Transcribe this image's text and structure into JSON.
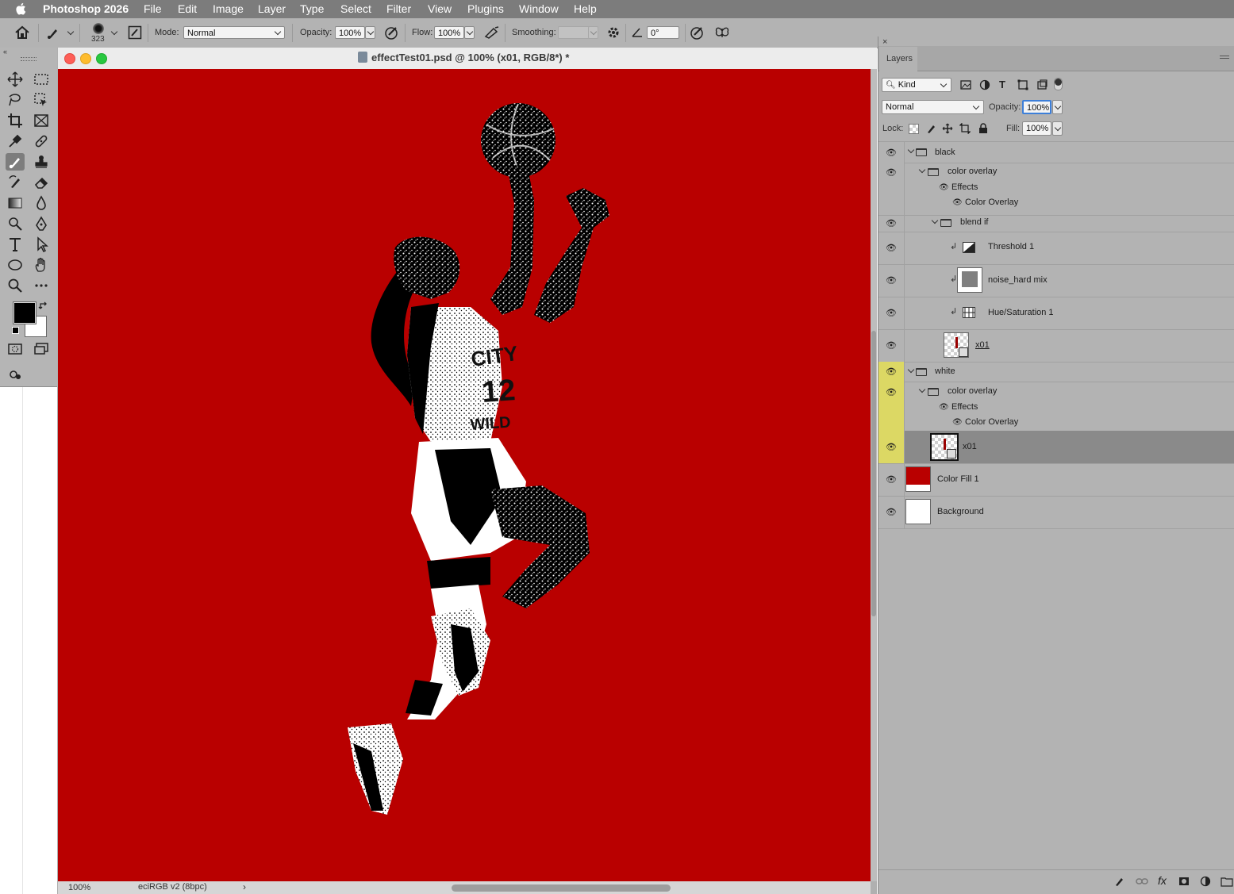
{
  "menubar": {
    "app_name": "Photoshop 2026",
    "items": [
      "File",
      "Edit",
      "Image",
      "Layer",
      "Type",
      "Select",
      "Filter",
      "View",
      "Plugins",
      "Window",
      "Help"
    ]
  },
  "options": {
    "brush_size": "323",
    "mode_label": "Mode:",
    "mode_value": "Normal",
    "opacity_label": "Opacity:",
    "opacity_value": "100%",
    "flow_label": "Flow:",
    "flow_value": "100%",
    "smoothing_label": "Smoothing:",
    "smoothing_value": "",
    "angle_value": "0°"
  },
  "document": {
    "title": "effectTest01.psd @ 100% (x01, RGB/8*) *",
    "zoom": "100%",
    "color_profile": "eciRGB v2 (8bpc)",
    "canvas_color": "#b90000"
  },
  "layers_panel": {
    "tab": "Layers",
    "filter_kind": "Kind",
    "blend_mode": "Normal",
    "opacity_label": "Opacity:",
    "opacity_value": "100%",
    "lock_label": "Lock:",
    "fill_label": "Fill:",
    "fill_value": "100%",
    "layers": [
      {
        "name": "black",
        "kind": "group"
      },
      {
        "name": "color overlay",
        "kind": "group"
      },
      {
        "name": "Effects",
        "kind": "effects"
      },
      {
        "name": "Color Overlay",
        "kind": "effect"
      },
      {
        "name": "blend if",
        "kind": "group"
      },
      {
        "name": "Threshold 1",
        "kind": "adjustment"
      },
      {
        "name": "noise_hard mix",
        "kind": "pixel"
      },
      {
        "name": "Hue/Saturation 1",
        "kind": "adjustment"
      },
      {
        "name": "x01",
        "kind": "smart-object"
      },
      {
        "name": "white",
        "kind": "group"
      },
      {
        "name": "color overlay",
        "kind": "group"
      },
      {
        "name": "Effects",
        "kind": "effects"
      },
      {
        "name": "Color Overlay",
        "kind": "effect"
      },
      {
        "name": "x01",
        "kind": "smart-object",
        "selected": true
      },
      {
        "name": "Color Fill 1",
        "kind": "fill"
      },
      {
        "name": "Background",
        "kind": "background"
      }
    ]
  },
  "colors": {
    "accent_yellow": "#dcd864",
    "fill_red": "#b90000"
  }
}
